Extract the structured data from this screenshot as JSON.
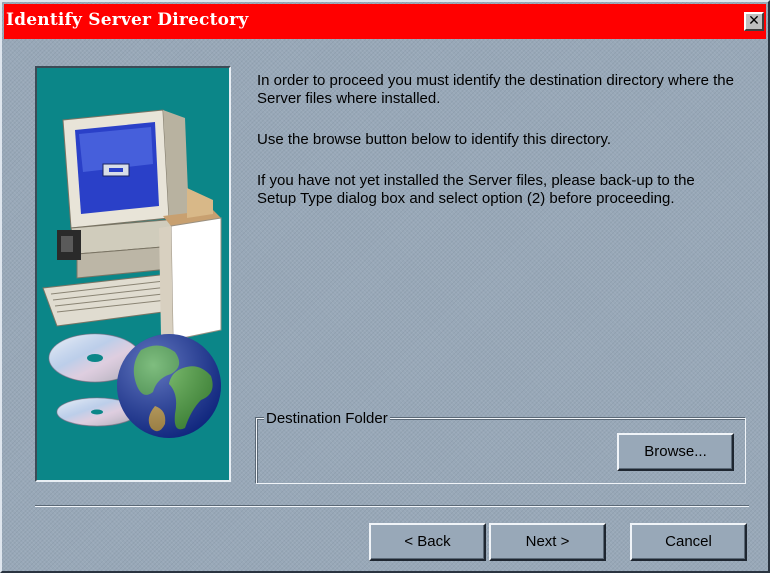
{
  "window": {
    "title": "Identify Server Directory",
    "close_glyph": "✕"
  },
  "content": {
    "paragraphs": [
      "In order to proceed you must identify the destination directory where the Server files where installed.",
      "Use the browse button below to identify this directory.",
      "If you have not yet installed the Server files, please back-up to the Setup Type dialog box and select option (2) before proceeding."
    ]
  },
  "destination": {
    "group_label": "Destination Folder",
    "browse_label": "Browse..."
  },
  "buttons": {
    "back_label": "< Back",
    "next_label": "Next >",
    "cancel_label": "Cancel"
  },
  "colors": {
    "title_bar": "#ff0000",
    "dialog_bg": "#98a8b8",
    "art_bg": "#0b8688"
  }
}
